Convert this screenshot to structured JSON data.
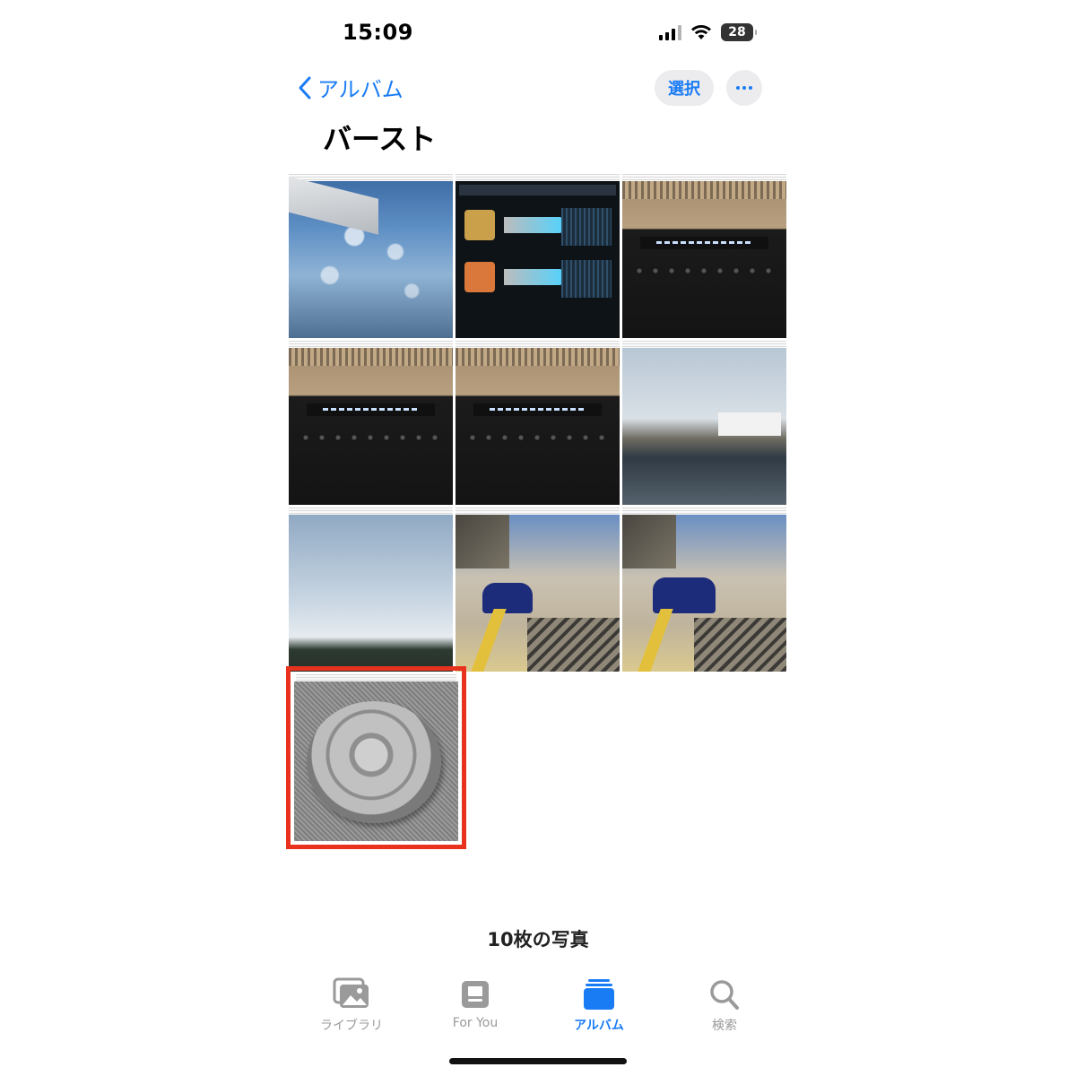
{
  "status": {
    "time": "15:09",
    "battery": "28"
  },
  "nav": {
    "back_label": "アルバム",
    "select_label": "選択"
  },
  "album": {
    "title": "バースト"
  },
  "photos": [
    {
      "subject": "airplane window view over clouds"
    },
    {
      "subject": "projector 4K UHD display slide",
      "caption": "UHD65/UHD60 - 4K UHD ディスプレイ",
      "spec1": "2716x1528X2＝8.3M",
      "spec2": "1920x1080X2＝4.14"
    },
    {
      "subject": "amplifier display",
      "display_text": "LINEAR PCM [2/0<96kH"
    },
    {
      "subject": "amplifier display",
      "display_text": "LINEAR PCM [2/0<96kH"
    },
    {
      "subject": "amplifier display",
      "display_text": "R PCM [2/0<96kHz>]"
    },
    {
      "subject": "harbor with bird and ship"
    },
    {
      "subject": "sky with clouds over hills"
    },
    {
      "subject": "blue train at station"
    },
    {
      "subject": "blue train at station"
    },
    {
      "subject": "metal lid on fabric",
      "selected": true
    }
  ],
  "photo_count": "10枚の写真",
  "tabs": [
    {
      "label": "ライブラリ",
      "icon": "photo-library-icon",
      "active": false
    },
    {
      "label": "For You",
      "icon": "for-you-icon",
      "active": false
    },
    {
      "label": "アルバム",
      "icon": "album-icon",
      "active": true
    },
    {
      "label": "検索",
      "icon": "search-icon",
      "active": false
    }
  ],
  "colors": {
    "accent": "#1a7cf5",
    "highlight": "#e8321e"
  }
}
